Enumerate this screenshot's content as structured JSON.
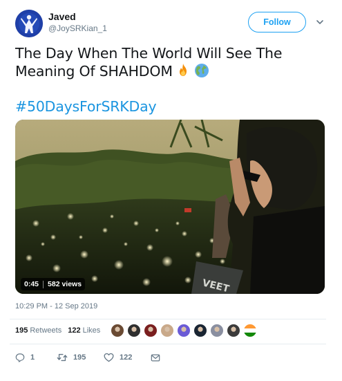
{
  "author": {
    "name": "Javed",
    "handle": "@JoySRKian_1",
    "follow_label": "Follow"
  },
  "tweet": {
    "text_line1": "The Day When The World Will See The",
    "text_line2": "Meaning Of SHAHDOM",
    "emojis": [
      "fire-emoji",
      "globe-emoji"
    ],
    "hashtag": "#50DaysForSRKDay",
    "timestamp": "10:29 PM - 12 Sep 2019"
  },
  "video": {
    "duration": "0:45",
    "views": "582 views",
    "overlay_text": "VEET"
  },
  "stats": {
    "retweets_count": "195",
    "retweets_label": "Retweets",
    "likes_count": "122",
    "likes_label": "Likes"
  },
  "liker_avatars": [
    "#6a4a33",
    "#2f2f2f",
    "#7a1f1f",
    "#c9a98a",
    "#6b5bd6",
    "#1a2533",
    "#8a8fa0",
    "#3b3b3b",
    "#ff9933"
  ],
  "actions": {
    "reply_count": "1",
    "retweet_count": "195",
    "like_count": "122"
  },
  "colors": {
    "accent": "#1da1f2",
    "hashtag": "#1b95e0",
    "muted": "#657786",
    "text": "#14171a",
    "retweet": "#17bf63"
  },
  "icons": {
    "caret": "chevron-down-icon",
    "reply": "reply-icon",
    "retweet": "retweet-icon",
    "like": "heart-icon",
    "dm": "envelope-icon"
  }
}
